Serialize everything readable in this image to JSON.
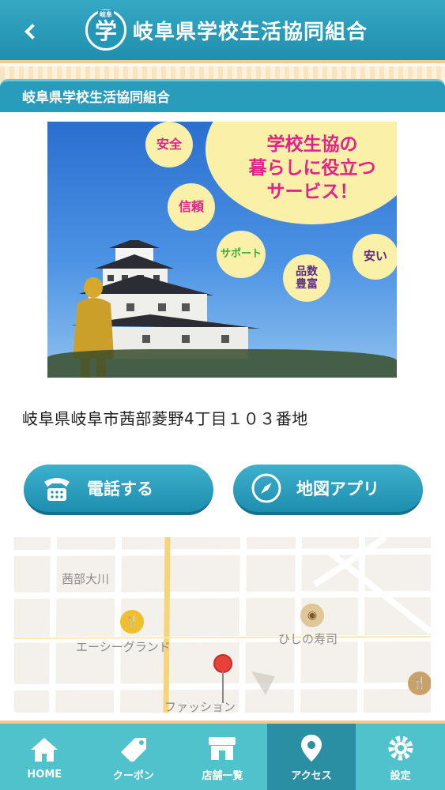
{
  "header": {
    "logo_char": "学",
    "logo_small": "岐阜",
    "title": "岐阜県学校生活協同組合"
  },
  "section": {
    "title": "岐阜県学校生活協同組合"
  },
  "banner": {
    "headline": [
      "学校生協の",
      "暮らしに役立つ",
      "サービス！"
    ],
    "bubbles": [
      "安全",
      "信頼",
      "サポート",
      "品数豊富",
      "安い"
    ]
  },
  "address": "岐阜県岐阜市茜部菱野4丁目１０３番地",
  "buttons": {
    "call": "電話する",
    "map": "地図アプリ"
  },
  "map": {
    "labels": [
      "茜部大川",
      "エーシーグランド",
      "ひしの寿司",
      "ファッション"
    ]
  },
  "tabbar": {
    "active_index": 3,
    "items": [
      {
        "label": "HOME",
        "icon": "home-icon"
      },
      {
        "label": "クーポン",
        "icon": "coupon-icon"
      },
      {
        "label": "店舗一覧",
        "icon": "store-icon"
      },
      {
        "label": "アクセス",
        "icon": "location-pin-icon"
      },
      {
        "label": "設定",
        "icon": "gear-icon"
      }
    ]
  },
  "colors": {
    "primary": "#2a9cbb",
    "accent_border": "#f3c98c",
    "tab_bg": "#4fc2cc",
    "tab_active": "#2b8fa3",
    "headline_pink": "#e2218a"
  }
}
